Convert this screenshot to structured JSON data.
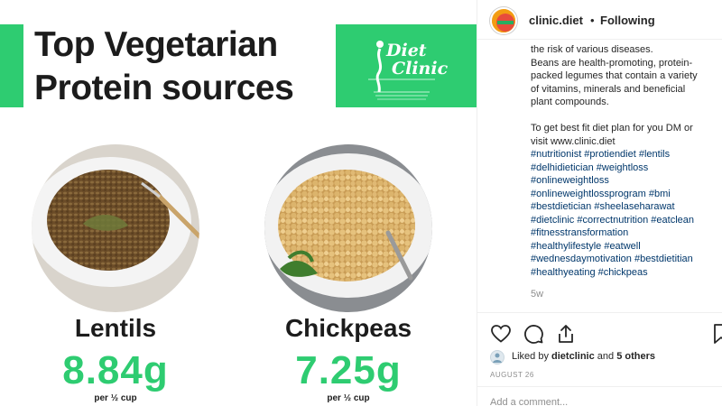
{
  "post_image": {
    "headline_line1": "Top Vegetarian",
    "headline_line2": "Protein sources",
    "logo_text_line1": "Diet",
    "logo_text_line2": "Clinic",
    "foods": [
      {
        "name": "Lentils",
        "value": "8.84g",
        "unit": "per ½ cup"
      },
      {
        "name": "Chickpeas",
        "value": "7.25g",
        "unit": "per ½ cup"
      }
    ],
    "colors": {
      "accent": "#2ecc71",
      "text": "#1c1c1c",
      "lentil": "#7a5a32",
      "chickpea": "#e2bf7a",
      "bowl": "#f2f2f2"
    }
  },
  "header": {
    "username": "clinic.diet",
    "separator": "•",
    "follow_status": "Following"
  },
  "caption": {
    "lines": [
      "the risk of various diseases.",
      "Beans are health-promoting, protein-",
      "packed legumes that contain a variety",
      "of vitamins, minerals and beneficial",
      "plant compounds."
    ],
    "cta_lines": [
      "To get best fit diet plan for you DM or",
      "visit www.clinic.diet"
    ],
    "hashtags": [
      "#nutritionist #protiendiet #lentils",
      "#delhidietician #weightloss",
      "#onlineweightloss",
      "#onlineweightlossprogram #bmi",
      "#bestdietician #sheelaseharawat",
      "#dietclinic #correctnutrition #eatclean",
      "#fitnesstransformation",
      "#healthylifestyle #eatwell",
      "#wednesdaymotivation #bestdietitian",
      "#healthyeating #chickpeas"
    ],
    "time_ago": "5w"
  },
  "actions": {
    "icons": [
      "heart-icon",
      "comment-icon",
      "share-icon",
      "bookmark-icon"
    ]
  },
  "likes": {
    "prefix": "Liked by ",
    "user": "dietclinic",
    "middle": " and ",
    "others": "5 others"
  },
  "post_date": "AUGUST 26",
  "comment_input": {
    "placeholder": "Add a comment..."
  }
}
